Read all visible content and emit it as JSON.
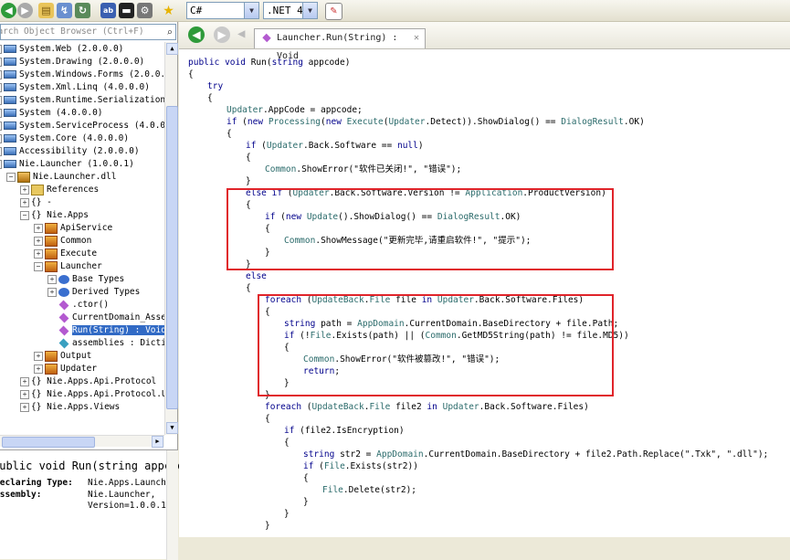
{
  "toolbar": {
    "language": "C#",
    "framework": ".NET 4.0",
    "dropdown_glyph": "▼"
  },
  "left": {
    "search_placeholder": "Search Object Browser (Ctrl+F)",
    "tree": [
      {
        "label": "System.Web (2.0.0.0)",
        "indent": 0,
        "expander": "+",
        "icon": "assembly"
      },
      {
        "label": "System.Drawing (2.0.0.0)",
        "indent": 0,
        "expander": "+",
        "icon": "assembly"
      },
      {
        "label": "System.Windows.Forms (2.0.0.0)",
        "indent": 0,
        "expander": "+",
        "icon": "assembly"
      },
      {
        "label": "System.Xml.Linq (4.0.0.0)",
        "indent": 0,
        "expander": "+",
        "icon": "assembly"
      },
      {
        "label": "System.Runtime.Serialization",
        "indent": 0,
        "expander": "+",
        "icon": "assembly"
      },
      {
        "label": "System (4.0.0.0)",
        "indent": 0,
        "expander": "+",
        "icon": "assembly"
      },
      {
        "label": "System.ServiceProcess (4.0.0.0)",
        "indent": 0,
        "expander": "+",
        "icon": "assembly"
      },
      {
        "label": "System.Core (4.0.0.0)",
        "indent": 0,
        "expander": "+",
        "icon": "assembly"
      },
      {
        "label": "Accessibility (2.0.0.0)",
        "indent": 0,
        "expander": "+",
        "icon": "assembly"
      },
      {
        "label": "Nie.Launcher (1.0.0.1)",
        "indent": 0,
        "expander": "-",
        "icon": "assembly"
      },
      {
        "label": "Nie.Launcher.dll",
        "indent": 1,
        "expander": "-",
        "icon": "dll"
      },
      {
        "label": "References",
        "indent": 2,
        "expander": "+",
        "icon": "folder"
      },
      {
        "label": "{} -",
        "indent": 2,
        "expander": "+",
        "icon": ""
      },
      {
        "label": "{} Nie.Apps",
        "indent": 2,
        "expander": "-",
        "icon": ""
      },
      {
        "label": "ApiService",
        "indent": 3,
        "expander": "+",
        "icon": "class"
      },
      {
        "label": "Common",
        "indent": 3,
        "expander": "+",
        "icon": "class"
      },
      {
        "label": "Execute",
        "indent": 3,
        "expander": "+",
        "icon": "class"
      },
      {
        "label": "Launcher",
        "indent": 3,
        "expander": "-",
        "icon": "class"
      },
      {
        "label": "Base Types",
        "indent": 4,
        "expander": "+",
        "icon": "basetypes"
      },
      {
        "label": "Derived Types",
        "indent": 4,
        "expander": "+",
        "icon": "derived"
      },
      {
        "label": ".ctor()",
        "indent": 4,
        "expander": "",
        "icon": "method"
      },
      {
        "label": "CurrentDomain_AssemblyResolve",
        "indent": 4,
        "expander": "",
        "icon": "method"
      },
      {
        "label": "Run(String) : Void",
        "indent": 4,
        "expander": "",
        "icon": "method",
        "selected": true
      },
      {
        "label": "assemblies : Dictionary",
        "indent": 4,
        "expander": "",
        "icon": "field"
      },
      {
        "label": "Output",
        "indent": 3,
        "expander": "+",
        "icon": "class"
      },
      {
        "label": "Updater",
        "indent": 3,
        "expander": "+",
        "icon": "class"
      },
      {
        "label": "{} Nie.Apps.Api.Protocol",
        "indent": 2,
        "expander": "+",
        "icon": ""
      },
      {
        "label": "{} Nie.Apps.Api.Protocol.U",
        "indent": 2,
        "expander": "+",
        "icon": ""
      },
      {
        "label": "{} Nie.Apps.Views",
        "indent": 2,
        "expander": "+",
        "icon": ""
      }
    ],
    "desc": {
      "signature": "public void Run(string appcode)",
      "declaring_label": "Declaring Type:",
      "declaring_value": "Nie.Apps.Launcher",
      "assembly_label": "Assembly:",
      "assembly_value_1": "Nie.Launcher,",
      "assembly_value_2": "Version=1.0.0.1"
    }
  },
  "right": {
    "tab_title": "Launcher.Run(String) : Void",
    "tab_close": "✕",
    "code_lines": [
      {
        "text": "public void Run(string appcode)",
        "indent": 0
      },
      {
        "text": "{",
        "indent": 0
      },
      {
        "text": "try",
        "indent": 1
      },
      {
        "text": "{",
        "indent": 1
      },
      {
        "text": "Updater.AppCode = appcode;",
        "indent": 2
      },
      {
        "text": "if (new Processing(new Execute(Updater.Detect)).ShowDialog() == DialogResult.OK)",
        "indent": 2
      },
      {
        "text": "{",
        "indent": 2
      },
      {
        "text": "if (Updater.Back.Software == null)",
        "indent": 3
      },
      {
        "text": "{",
        "indent": 3
      },
      {
        "text": "Common.ShowError(\"软件已关闭!\", \"错误\");",
        "indent": 4
      },
      {
        "text": "}",
        "indent": 3
      },
      {
        "text": "else if (Updater.Back.Software.Version != Application.ProductVersion)",
        "indent": 3
      },
      {
        "text": "{",
        "indent": 3
      },
      {
        "text": "if (new Update().ShowDialog() == DialogResult.OK)",
        "indent": 4
      },
      {
        "text": "{",
        "indent": 4
      },
      {
        "text": "Common.ShowMessage(\"更新完毕,请重启软件!\", \"提示\");",
        "indent": 5
      },
      {
        "text": "}",
        "indent": 4
      },
      {
        "text": "}",
        "indent": 3
      },
      {
        "text": "else",
        "indent": 3
      },
      {
        "text": "{",
        "indent": 3
      },
      {
        "text": "foreach (UpdateBack.File file in Updater.Back.Software.Files)",
        "indent": 4
      },
      {
        "text": "{",
        "indent": 4
      },
      {
        "text": "string path = AppDomain.CurrentDomain.BaseDirectory + file.Path;",
        "indent": 5
      },
      {
        "text": "if (!File.Exists(path) || (Common.GetMD5String(path) != file.MD5))",
        "indent": 5
      },
      {
        "text": "{",
        "indent": 5
      },
      {
        "text": "Common.ShowError(\"软件被篡改!\", \"错误\");",
        "indent": 6
      },
      {
        "text": "return;",
        "indent": 6
      },
      {
        "text": "}",
        "indent": 5
      },
      {
        "text": "}",
        "indent": 4
      },
      {
        "text": "foreach (UpdateBack.File file2 in Updater.Back.Software.Files)",
        "indent": 4
      },
      {
        "text": "{",
        "indent": 4
      },
      {
        "text": "if (file2.IsEncryption)",
        "indent": 5
      },
      {
        "text": "{",
        "indent": 5
      },
      {
        "text": "string str2 = AppDomain.CurrentDomain.BaseDirectory + file2.Path.Replace(\".Txk\", \".dll\");",
        "indent": 6
      },
      {
        "text": "if (File.Exists(str2))",
        "indent": 6
      },
      {
        "text": "{",
        "indent": 6
      },
      {
        "text": "File.Delete(str2);",
        "indent": 7
      },
      {
        "text": "}",
        "indent": 6
      },
      {
        "text": "}",
        "indent": 5
      },
      {
        "text": "}",
        "indent": 4
      }
    ]
  },
  "colors": {
    "keyword": "#00008b",
    "type": "#2b6b6b",
    "selection": "#316ac5",
    "highlight_box": "#e0242a",
    "nav_back": "#2e9a3a"
  }
}
